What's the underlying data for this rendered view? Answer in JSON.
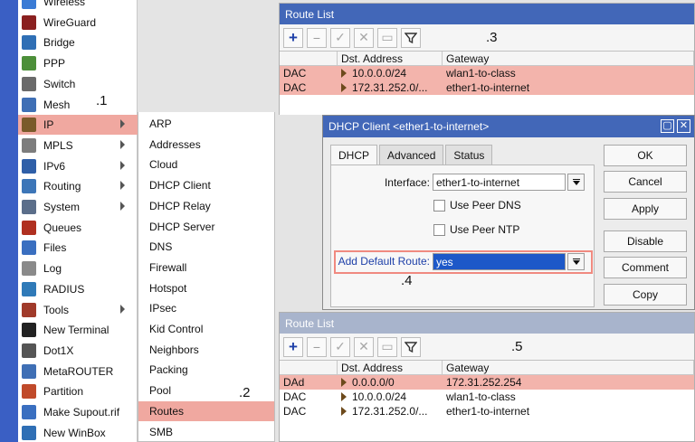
{
  "main_menu": {
    "items": [
      {
        "label": "Wireless",
        "icon": "wireless-icon",
        "color": "#3a7bd5",
        "submenu": false
      },
      {
        "label": "WireGuard",
        "icon": "wireguard-icon",
        "color": "#8a2020",
        "submenu": false
      },
      {
        "label": "Bridge",
        "icon": "bridge-icon",
        "color": "#2f6fb5",
        "submenu": false
      },
      {
        "label": "PPP",
        "icon": "ppp-icon",
        "color": "#4d8f3a",
        "submenu": false
      },
      {
        "label": "Switch",
        "icon": "switch-icon",
        "color": "#6a6a6a",
        "submenu": false
      },
      {
        "label": "Mesh",
        "icon": "mesh-icon",
        "color": "#3f6fb5",
        "submenu": false
      },
      {
        "label": "IP",
        "icon": "ip-icon",
        "color": "#7a5a2a",
        "submenu": true
      },
      {
        "label": "MPLS",
        "icon": "mpls-icon",
        "color": "#7d7d7d",
        "submenu": true
      },
      {
        "label": "IPv6",
        "icon": "ipv6-icon",
        "color": "#2f5fa8",
        "submenu": true
      },
      {
        "label": "Routing",
        "icon": "routing-icon",
        "color": "#3d76b8",
        "submenu": true
      },
      {
        "label": "System",
        "icon": "system-icon",
        "color": "#5b6e8a",
        "submenu": true
      },
      {
        "label": "Queues",
        "icon": "queues-icon",
        "color": "#b03020",
        "submenu": false
      },
      {
        "label": "Files",
        "icon": "files-icon",
        "color": "#3a6fc0",
        "submenu": false
      },
      {
        "label": "Log",
        "icon": "log-icon",
        "color": "#8a8a8a",
        "submenu": false
      },
      {
        "label": "RADIUS",
        "icon": "radius-icon",
        "color": "#2f7ab8",
        "submenu": false
      },
      {
        "label": "Tools",
        "icon": "tools-icon",
        "color": "#a03a2a",
        "submenu": true
      },
      {
        "label": "New Terminal",
        "icon": "terminal-icon",
        "color": "#222222",
        "submenu": false
      },
      {
        "label": "Dot1X",
        "icon": "dot1x-icon",
        "color": "#555555",
        "submenu": false
      },
      {
        "label": "MetaROUTER",
        "icon": "metarouter-icon",
        "color": "#3f6fb5",
        "submenu": false
      },
      {
        "label": "Partition",
        "icon": "partition-icon",
        "color": "#c04a2a",
        "submenu": false
      },
      {
        "label": "Make Supout.rif",
        "icon": "supout-icon",
        "color": "#3a6fc0",
        "submenu": false
      },
      {
        "label": "New WinBox",
        "icon": "winbox-icon",
        "color": "#2f6fb5",
        "submenu": false
      }
    ],
    "annotation": ".1"
  },
  "ip_submenu": {
    "items": [
      "ARP",
      "Addresses",
      "Cloud",
      "DHCP Client",
      "DHCP Relay",
      "DHCP Server",
      "DNS",
      "Firewall",
      "Hotspot",
      "IPsec",
      "Kid Control",
      "Neighbors",
      "Packing",
      "Pool",
      "Routes",
      "SMB"
    ],
    "annotation": ".2"
  },
  "route_list_top": {
    "title": "Route List",
    "annotation": ".3",
    "columns": [
      "Dst. Address",
      "Gateway"
    ],
    "rows": [
      {
        "flags": "DAC",
        "dst": "10.0.0.0/24",
        "gateway": "wlan1-to-class"
      },
      {
        "flags": "DAC",
        "dst": "172.31.252.0/...",
        "gateway": "ether1-to-internet"
      }
    ]
  },
  "dhcp_dialog": {
    "title": "DHCP Client <ether1-to-internet>",
    "tabs": [
      "DHCP",
      "Advanced",
      "Status"
    ],
    "interface_label": "Interface:",
    "interface_value": "ether1-to-internet",
    "use_peer_dns": "Use Peer DNS",
    "use_peer_ntp": "Use Peer NTP",
    "default_route_label": "Add Default Route:",
    "default_route_value": "yes",
    "annotation": ".4",
    "buttons": [
      "OK",
      "Cancel",
      "Apply",
      "Disable",
      "Comment",
      "Copy"
    ]
  },
  "route_list_bottom": {
    "title": "Route List",
    "annotation": ".5",
    "columns": [
      "Dst. Address",
      "Gateway"
    ],
    "rows": [
      {
        "flags": "DAd",
        "dst": "0.0.0.0/0",
        "gateway": "172.31.252.254"
      },
      {
        "flags": "DAC",
        "dst": "10.0.0.0/24",
        "gateway": "wlan1-to-class"
      },
      {
        "flags": "DAC",
        "dst": "172.31.252.0/...",
        "gateway": "ether1-to-internet"
      }
    ]
  }
}
